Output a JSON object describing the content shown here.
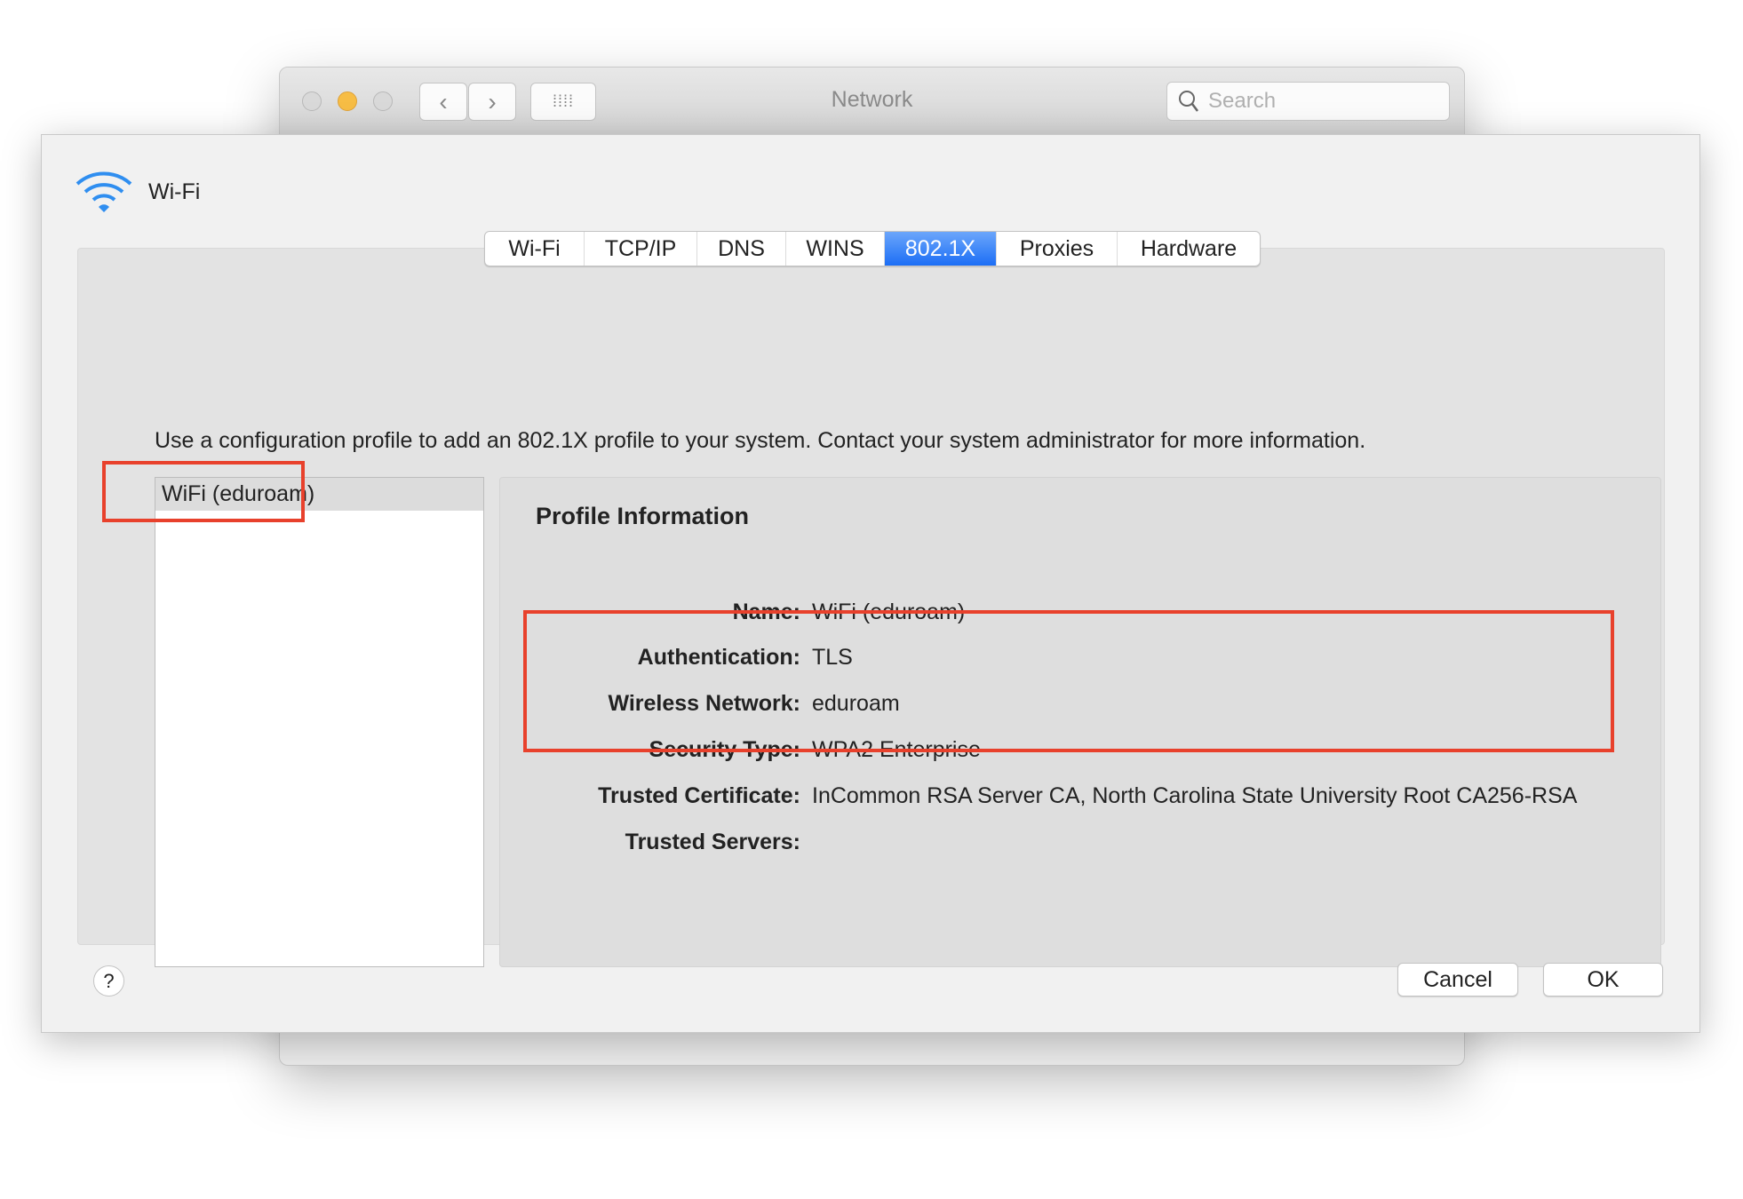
{
  "window": {
    "title": "Network",
    "search_placeholder": "Search"
  },
  "sheet": {
    "service_name": "Wi-Fi",
    "tabs": [
      {
        "label": "Wi-Fi"
      },
      {
        "label": "TCP/IP"
      },
      {
        "label": "DNS"
      },
      {
        "label": "WINS"
      },
      {
        "label": "802.1X",
        "selected": true
      },
      {
        "label": "Proxies"
      },
      {
        "label": "Hardware"
      }
    ],
    "description": "Use a configuration profile to add an 802.1X profile to your system. Contact your system administrator for more information.",
    "profiles": [
      {
        "label": "WiFi (eduroam)"
      }
    ],
    "profile_info": {
      "title": "Profile Information",
      "rows": [
        {
          "key": "Name:",
          "value": "WiFi (eduroam)"
        },
        {
          "key": "Authentication:",
          "value": "TLS"
        },
        {
          "key": "Wireless Network:",
          "value": "eduroam"
        },
        {
          "key": "Security Type:",
          "value": "WPA2 Enterprise"
        },
        {
          "key": "Trusted Certificate:",
          "value": "InCommon RSA Server CA, North Carolina State University Root CA256-RSA"
        },
        {
          "key": "Trusted Servers:",
          "value": ""
        }
      ]
    },
    "help_label": "?",
    "cancel_label": "Cancel",
    "ok_label": "OK"
  },
  "colors": {
    "accent": "#1c6ef5",
    "highlight": "#e8412c"
  }
}
